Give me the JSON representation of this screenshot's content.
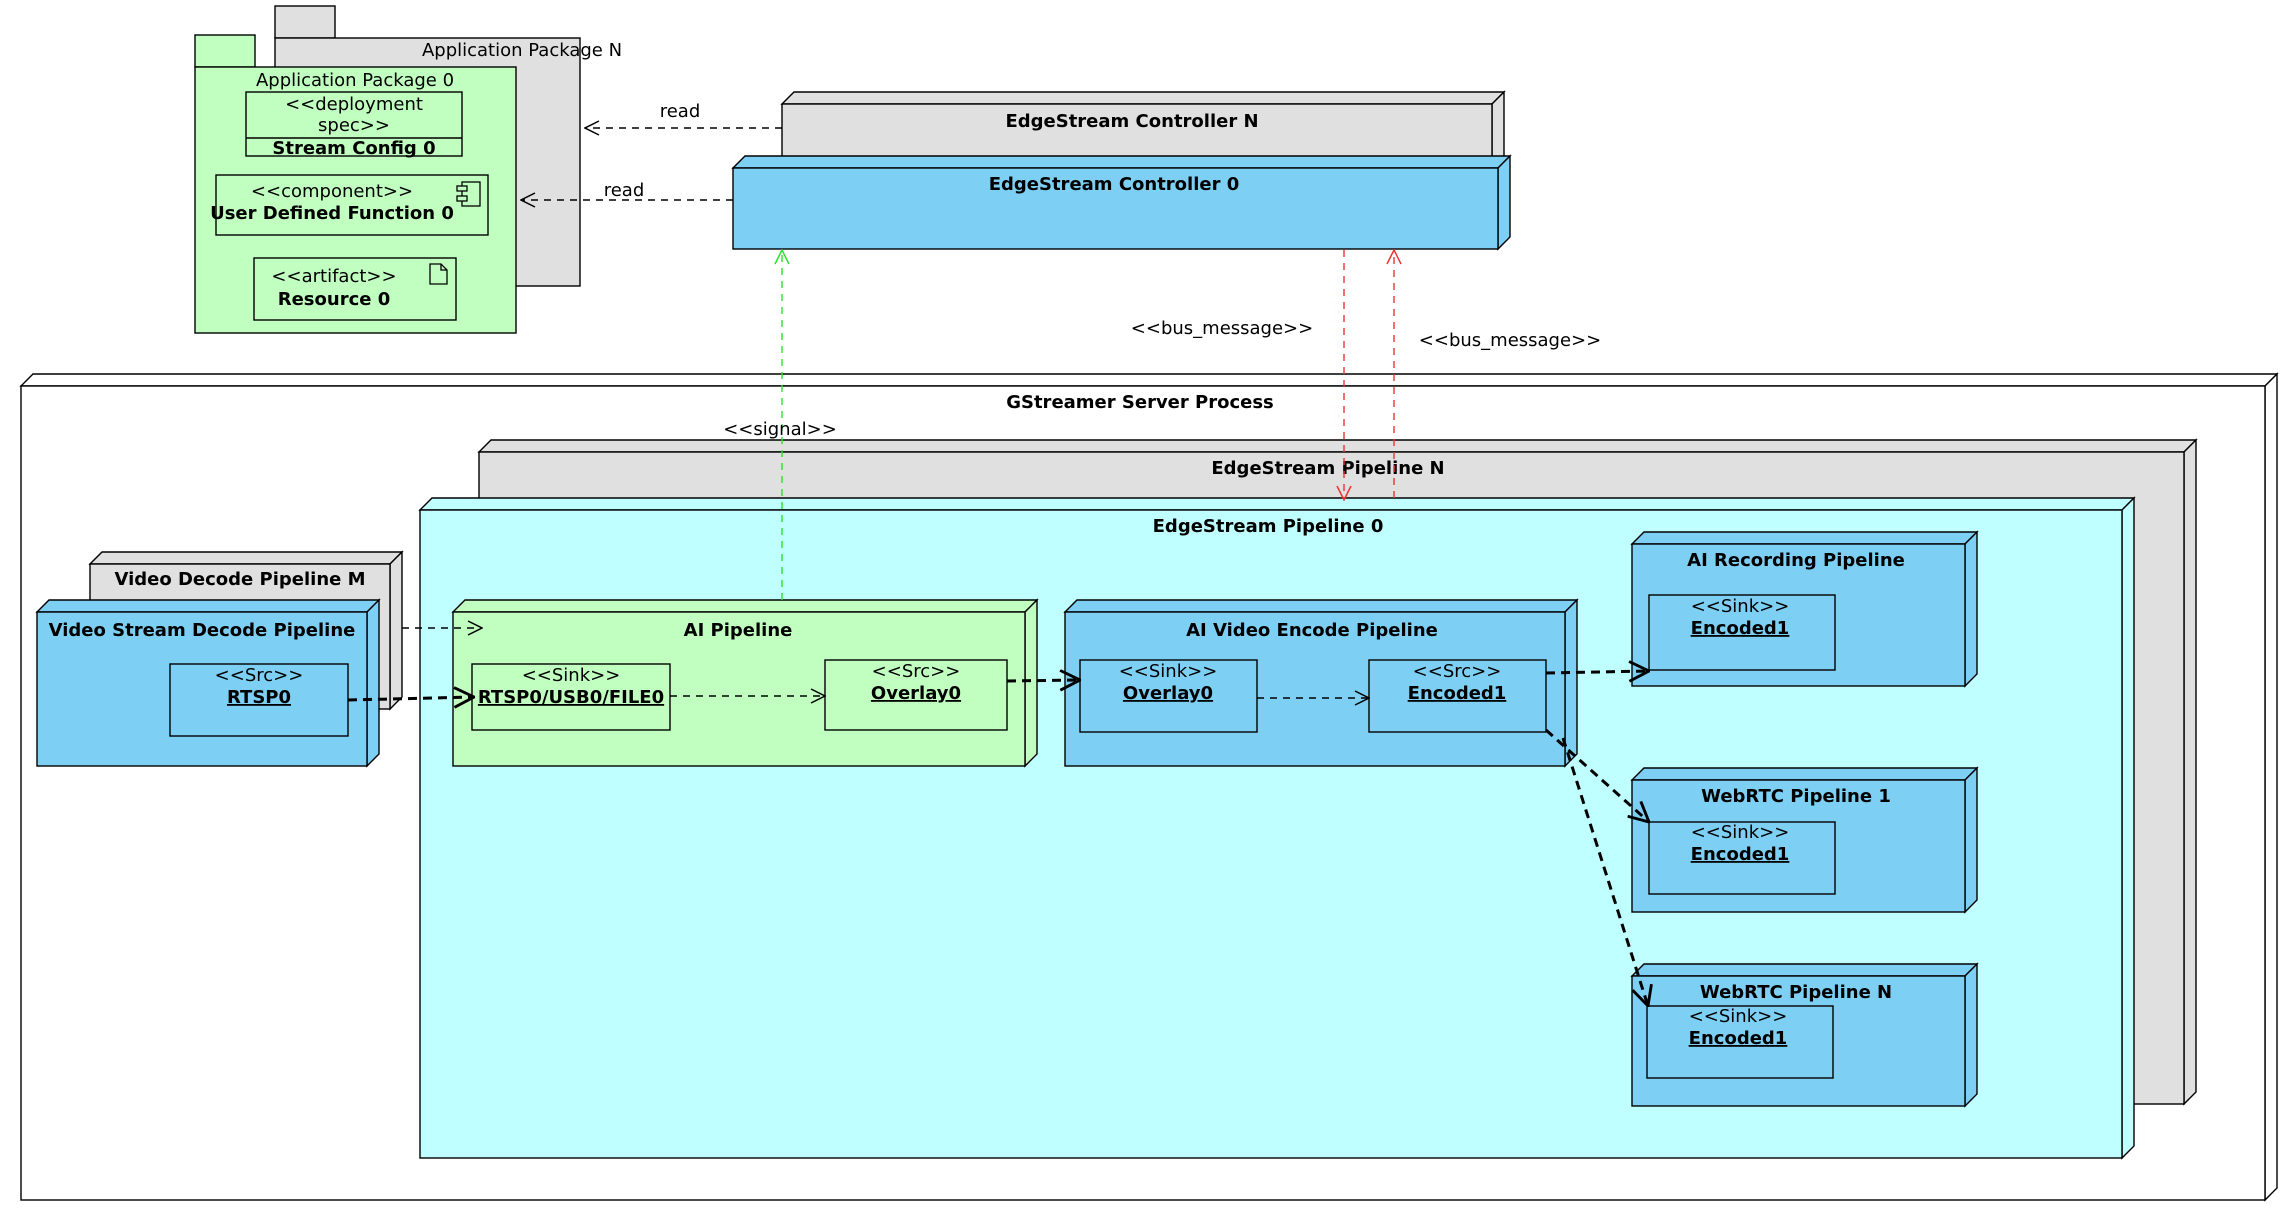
{
  "colors": {
    "green": "#c0ffc0",
    "blue": "#7dcff3",
    "cyan": "#c0ffff",
    "gray": "#e0e0e0",
    "signal_arrow": "#33dd33",
    "bus_arrow": "#ee3333"
  },
  "app_packages": {
    "back_title": "Application Package N",
    "front_title": "Application Package 0",
    "stream_config": {
      "stereotype_line1": "<<deployment",
      "stereotype_line2": "spec>>",
      "name": "Stream Config 0"
    },
    "udf": {
      "stereotype": "<<component>>",
      "name": "User Defined Function 0",
      "icon": "component-icon"
    },
    "resource": {
      "stereotype": "<<artifact>>",
      "name": "Resource 0",
      "icon": "document-icon"
    }
  },
  "controllers": {
    "back": "EdgeStream Controller N",
    "front": "EdgeStream Controller 0"
  },
  "labels": {
    "read_1": "read",
    "read_2": "read",
    "bus_message_1": "<<bus_message>>",
    "bus_message_2": "<<bus_message>>",
    "signal": "<<signal>>"
  },
  "server": {
    "title": "GStreamer Server Process",
    "pipeline_back": "EdgeStream Pipeline N",
    "pipeline_front": "EdgeStream Pipeline 0"
  },
  "decode": {
    "back": "Video Decode Pipeline M",
    "front": "Video Stream Decode Pipeline",
    "src": {
      "stereotype": "<<Src>>",
      "name": "RTSP0"
    }
  },
  "ai_pipeline": {
    "title": "AI Pipeline",
    "sink": {
      "stereotype": "<<Sink>>",
      "name": "RTSP0/USB0/FILE0"
    },
    "src": {
      "stereotype": "<<Src>>",
      "name": "Overlay0"
    }
  },
  "encode_pipeline": {
    "title": "AI Video Encode Pipeline",
    "sink": {
      "stereotype": "<<Sink>>",
      "name": "Overlay0"
    },
    "src": {
      "stereotype": "<<Src>>",
      "name": "Encoded1"
    }
  },
  "outputs": [
    {
      "title": "AI Recording Pipeline",
      "stereotype": "<<Sink>>",
      "name": "Encoded1"
    },
    {
      "title": "WebRTC Pipeline 1",
      "stereotype": "<<Sink>>",
      "name": "Encoded1"
    },
    {
      "title": "WebRTC Pipeline N",
      "stereotype": "<<Sink>>",
      "name": "Encoded1"
    }
  ]
}
